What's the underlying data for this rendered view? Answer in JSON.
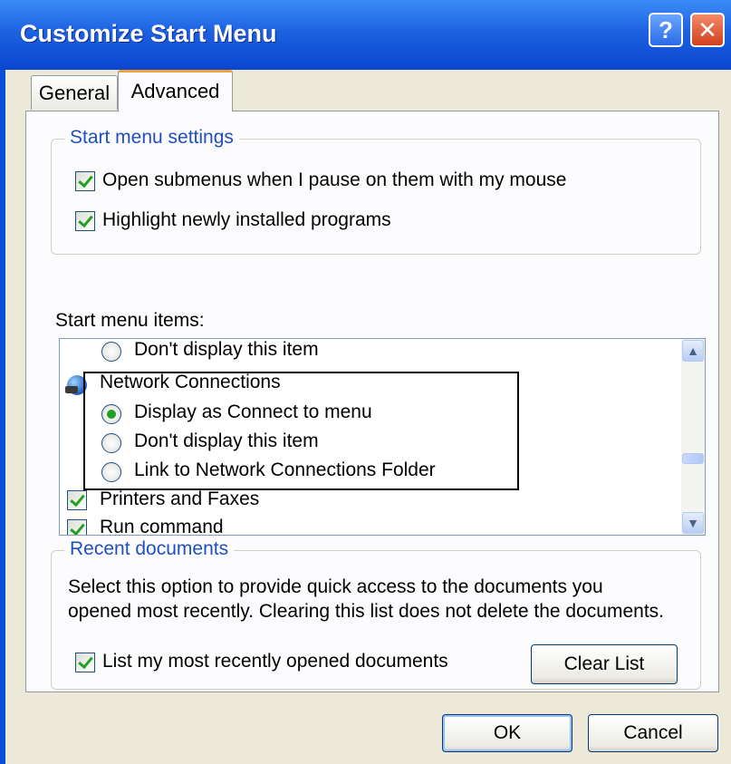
{
  "window": {
    "title": "Customize Start Menu",
    "help_glyph": "?",
    "close_glyph": "✕"
  },
  "tabs": [
    {
      "label": "General"
    },
    {
      "label": "Advanced",
      "selected": true
    }
  ],
  "start_menu_settings": {
    "title": "Start menu settings",
    "options": [
      {
        "label": "Open submenus when I pause on them with my mouse",
        "checked": true
      },
      {
        "label": "Highlight newly installed programs",
        "checked": true
      }
    ]
  },
  "start_menu_items": {
    "label": "Start menu items:",
    "items": [
      {
        "type": "radio",
        "label": "Don't display this item",
        "checked": false
      },
      {
        "type": "header",
        "label": "Network Connections",
        "icon": "network-globe-icon"
      },
      {
        "type": "radio",
        "label": "Display as Connect to menu",
        "checked": true
      },
      {
        "type": "radio",
        "label": "Don't display this item",
        "checked": false
      },
      {
        "type": "radio",
        "label": "Link to Network Connections Folder",
        "checked": false
      },
      {
        "type": "checkbox",
        "label": "Printers and Faxes",
        "checked": true
      },
      {
        "type": "checkbox",
        "label": "Run command",
        "checked": true
      }
    ],
    "scroll_up": "▲",
    "scroll_down": "▼"
  },
  "recent_documents": {
    "title": "Recent documents",
    "description_line1": "Select this option to provide quick access to the documents you",
    "description_line2": "opened most recently.  Clearing this list does not delete the documents.",
    "option": {
      "label": "List my most recently opened documents",
      "checked": true
    },
    "clear_button": "Clear List"
  },
  "footer": {
    "ok": "OK",
    "cancel": "Cancel"
  },
  "colors": {
    "titlebar": "#0b4fd8",
    "dialog_bg": "#ece9d8",
    "group_title": "#1f4fc2",
    "check": "#21a121"
  }
}
